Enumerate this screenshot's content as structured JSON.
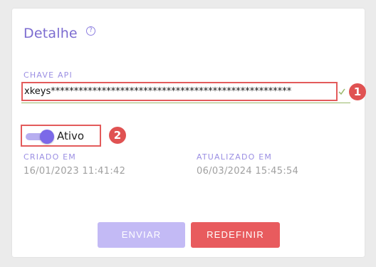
{
  "card": {
    "title": "Detalhe",
    "help_icon": "question-circle-icon",
    "help_glyph": "?"
  },
  "api_key": {
    "label": "CHAVE API",
    "value": "xkeys****************************************************",
    "valid_icon": "check-icon",
    "annotation": "1"
  },
  "status": {
    "label": "Ativo",
    "enabled": true,
    "annotation": "2"
  },
  "created": {
    "label": "CRIADO EM",
    "value": "16/01/2023 11:41:42"
  },
  "updated": {
    "label": "ATUALIZADO EM",
    "value": "06/03/2024 15:45:54"
  },
  "actions": {
    "send_label": "ENVIAR",
    "reset_label": "REDEFINIR"
  },
  "colors": {
    "accent": "#7c6cd0",
    "toggle_on": "#7b69e8",
    "danger": "#e85b5e",
    "valid": "#9ab86a"
  }
}
